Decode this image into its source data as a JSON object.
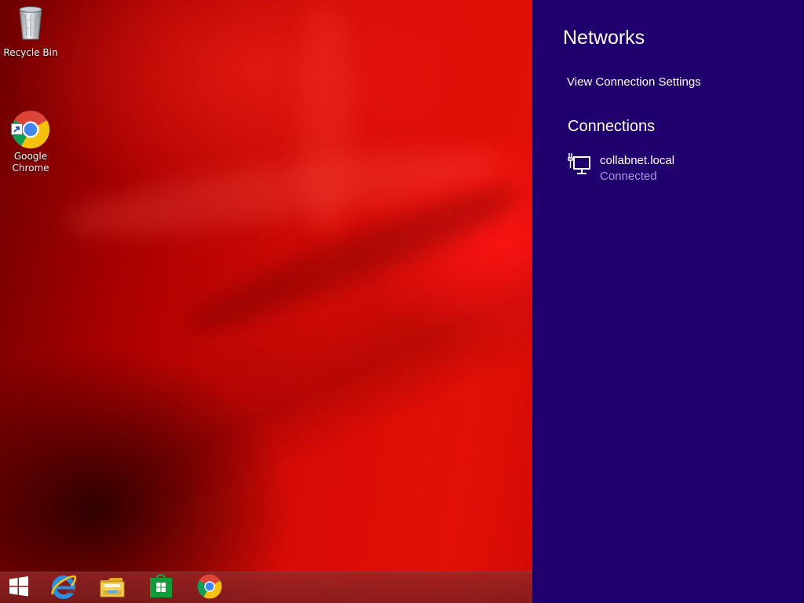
{
  "desktop": {
    "icons": [
      {
        "label": "Recycle Bin",
        "icon": "recycle-bin-icon"
      },
      {
        "label": "Google\nChrome",
        "icon": "chrome-icon"
      }
    ]
  },
  "taskbar": {
    "items": [
      {
        "name": "start",
        "icon": "windows-logo-icon"
      },
      {
        "name": "internet-explorer",
        "icon": "internet-explorer-icon"
      },
      {
        "name": "file-explorer",
        "icon": "folder-icon"
      },
      {
        "name": "store",
        "icon": "store-icon"
      },
      {
        "name": "google-chrome",
        "icon": "chrome-icon"
      }
    ]
  },
  "charm": {
    "title": "Networks",
    "view_settings_label": "View Connection Settings",
    "connections_heading": "Connections",
    "connections": [
      {
        "name": "collabnet.local",
        "status": "Connected",
        "icon": "wired-network-icon"
      }
    ]
  },
  "colors": {
    "charm_background": "#1f006c",
    "status_text": "#a99be0",
    "wallpaper_primary": "#d80b06"
  }
}
